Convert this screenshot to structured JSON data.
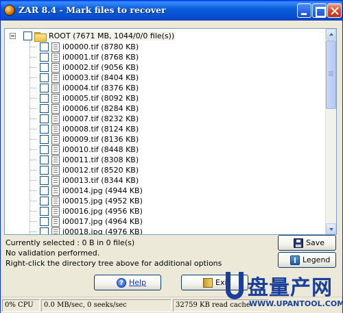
{
  "window": {
    "title": "ZAR 8.4 - Mark files to recover"
  },
  "tree": {
    "root_label": "ROOT (7671 MB, 1044/0/0 file(s))",
    "files": [
      "i00000.tif (8780 KB)",
      "i00001.tif (8768 KB)",
      "i00002.tif (9056 KB)",
      "i00003.tif (8404 KB)",
      "i00004.tif (8376 KB)",
      "i00005.tif (8092 KB)",
      "i00006.tif (8284 KB)",
      "i00007.tif (8232 KB)",
      "i00008.tif (8124 KB)",
      "i00009.tif (8136 KB)",
      "i00010.tif (8448 KB)",
      "i00011.tif (8308 KB)",
      "i00012.tif (8520 KB)",
      "i00013.tif (8344 KB)",
      "i00014.jpg (4944 KB)",
      "i00015.jpg (4952 KB)",
      "i00016.jpg (4956 KB)",
      "i00017.jpg (4964 KB)",
      "i00018.jpg (4976 KB)"
    ]
  },
  "info": {
    "selected": "Currently selected : 0 B in 0 file(s)",
    "validation": "No validation performed.",
    "hint": "Right-click the directory tree above for additional options"
  },
  "buttons": {
    "save": "Save",
    "legend": "Legend",
    "help": "Help",
    "exit": "Exit"
  },
  "status": {
    "cpu": "0% CPU",
    "io": "0.0 MB/sec, 0 seeks/sec",
    "cache": "32759 KB read cache"
  },
  "watermark": {
    "text": "盘量产网",
    "url": "WWW.UPANTOOL.COM"
  }
}
